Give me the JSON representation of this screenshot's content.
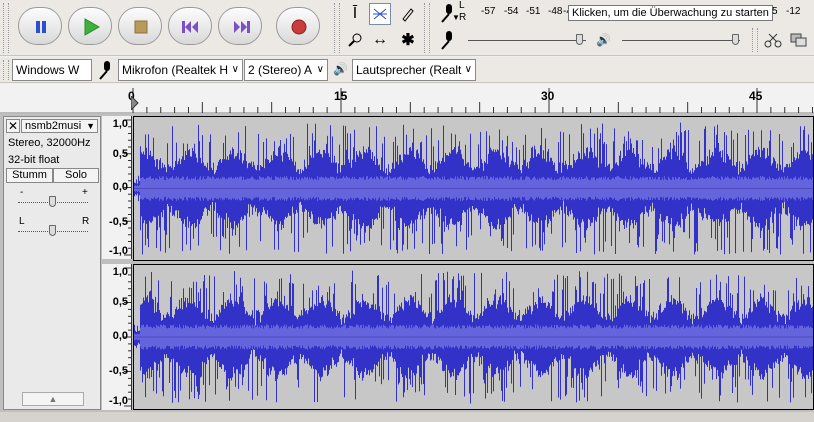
{
  "transport": {
    "buttons": [
      "pause-button",
      "play-button",
      "stop-button",
      "skip-start-button",
      "skip-end-button",
      "record-button"
    ]
  },
  "meter": {
    "record_channels": {
      "l": "L",
      "r": "R"
    },
    "scale": [
      "-57",
      "-54",
      "-51",
      "-48",
      "-4"
    ],
    "scale_right": [
      "5",
      "-12"
    ],
    "tooltip": "Klicken, um die Überwachung zu starten"
  },
  "devices": {
    "host": "Windows W",
    "mic": "Mikrofon (Realtek H",
    "channels": "2 (Stereo) A",
    "speaker": "Lautsprecher (Realt"
  },
  "ruler": {
    "labels": [
      "0",
      "15",
      "30",
      "45"
    ]
  },
  "track": {
    "name": "nsmb2musi",
    "info1": "Stereo, 32000Hz",
    "info2": "32-bit float",
    "mute": "Stumm",
    "solo": "Solo",
    "gain_minus": "-",
    "gain_plus": "+",
    "pan_left": "L",
    "pan_right": "R"
  },
  "vruler": {
    "labels": [
      "1,0",
      "0,5",
      "0,0",
      "-0,5",
      "-1,0"
    ]
  },
  "colors": {
    "wave": "#3232c8",
    "wave_bg": "#c7c7c7",
    "selected_tool": "#ffffff"
  }
}
